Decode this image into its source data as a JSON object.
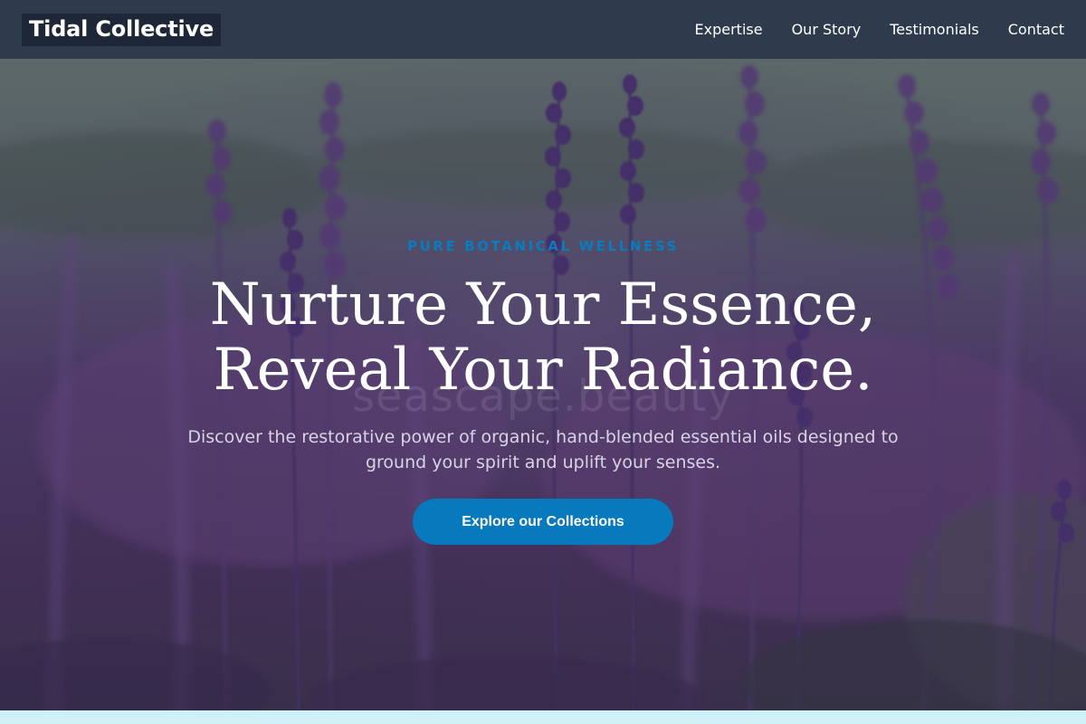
{
  "header": {
    "brand": "Tidal Collective",
    "nav": [
      "Expertise",
      "Our Story",
      "Testimonials",
      "Contact"
    ]
  },
  "hero": {
    "eyebrow": "PURE BOTANICAL WELLNESS",
    "headline_line1": "Nurture Your Essence,",
    "headline_line2": "Reveal Your Radiance.",
    "subtext": "Discover the restorative power of organic, hand-blended essential oils designed to ground your spirit and uplift your senses.",
    "cta_label": "Explore our Collections",
    "watermark": "seascape.beauty",
    "background_image": "lavender-field-photo"
  },
  "colors": {
    "header_bg": "#2e3b4d",
    "brand_bg": "#1d2738",
    "accent": "#0779bd",
    "eyebrow": "#0a7bbf",
    "bottom_strip": "#cdf1f7"
  }
}
